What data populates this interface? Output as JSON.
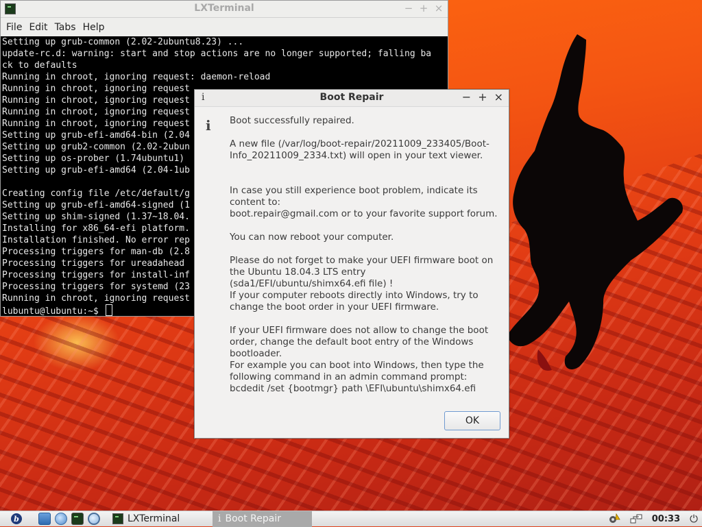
{
  "terminal": {
    "title": "LXTerminal",
    "menu": [
      "File",
      "Edit",
      "Tabs",
      "Help"
    ],
    "lines": [
      "Setting up grub-common (2.02-2ubuntu8.23) ...",
      "update-rc.d: warning: start and stop actions are no longer supported; falling ba",
      "ck to defaults",
      "Running in chroot, ignoring request: daemon-reload",
      "Running in chroot, ignoring request",
      "Running in chroot, ignoring request",
      "Running in chroot, ignoring request",
      "Running in chroot, ignoring request",
      "Setting up grub-efi-amd64-bin (2.04",
      "Setting up grub2-common (2.02-2ubun",
      "Setting up os-prober (1.74ubuntu1)",
      "Setting up grub-efi-amd64 (2.04-1ub",
      "",
      "Creating config file /etc/default/g",
      "Setting up grub-efi-amd64-signed (1",
      "Setting up shim-signed (1.37~18.04.",
      "Installing for x86_64-efi platform.",
      "Installation finished. No error rep",
      "Processing triggers for man-db (2.8",
      "Processing triggers for ureadahead",
      "Processing triggers for install-inf",
      "Processing triggers for systemd (23",
      "Running in chroot, ignoring request"
    ],
    "prompt": "lubuntu@lubuntu:~$ "
  },
  "dialog": {
    "title": "Boot Repair",
    "title_icon": "i",
    "paragraphs": [
      "Boot successfully repaired.",
      "A new file (/var/log/boot-repair/20211009_233405/Boot-Info_20211009_2334.txt) will open in your text viewer.",
      "In case you still experience boot problem, indicate its content to:\nboot.repair@gmail.com or to your favorite support forum.",
      "You can now reboot your computer.",
      "Please do not forget to make your UEFI firmware boot on the Ubuntu 18.04.3 LTS entry (sda1/EFI/ubuntu/shimx64.efi file) !\nIf your computer reboots directly into Windows, try to change the boot order in your UEFI firmware.",
      "If your UEFI firmware does not allow to change the boot order, change the default boot entry of the Windows bootloader.\nFor example you can boot into Windows, then type the following command in an admin command prompt:\nbcdedit /set {bootmgr} path \\EFI\\ubuntu\\shimx64.efi"
    ],
    "ok_label": "OK"
  },
  "taskbar": {
    "tasks": [
      {
        "label": "LXTerminal",
        "icon": "terminal-icon"
      },
      {
        "label": "Boot Repair",
        "icon": "info-icon"
      }
    ],
    "clock": "00:33"
  }
}
